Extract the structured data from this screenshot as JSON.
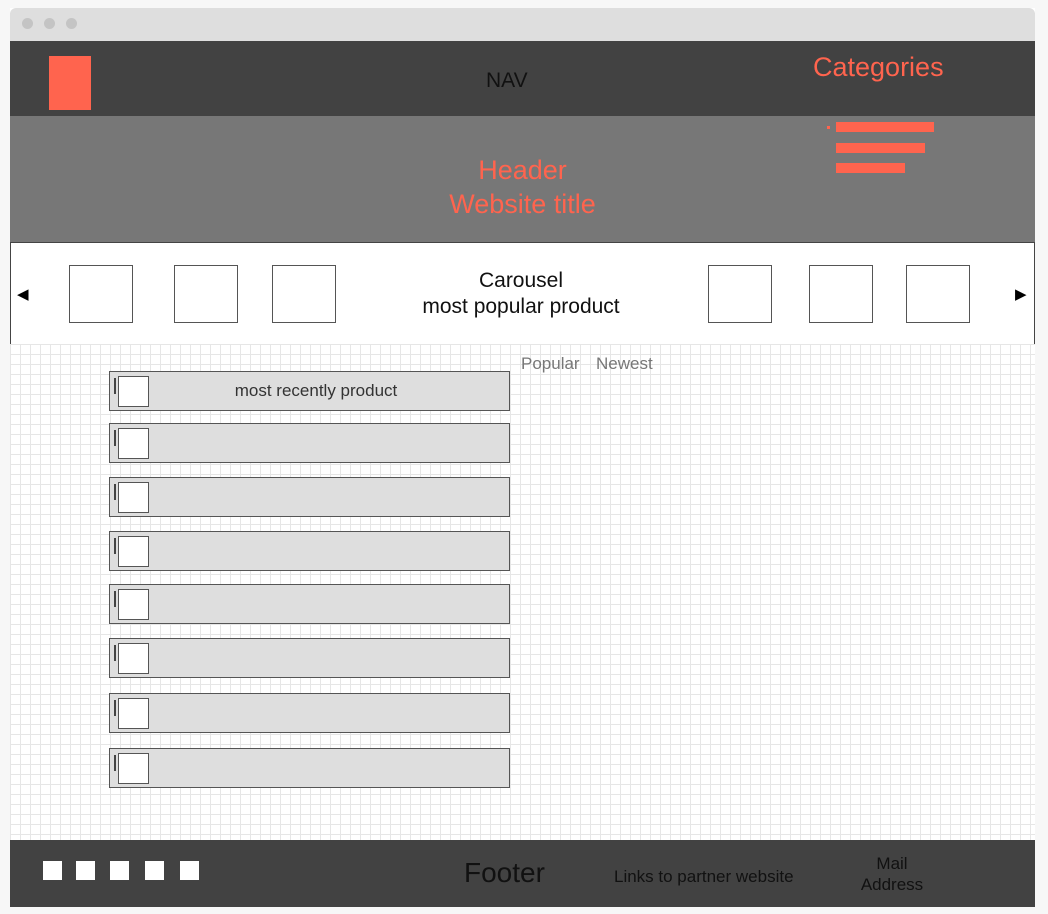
{
  "window": {
    "controls": [
      "close",
      "minimize",
      "maximize"
    ]
  },
  "nav": {
    "label": "NAV",
    "logo_color": "#ff644e"
  },
  "categories": {
    "label": "Categories",
    "icon": "hamburger-menu-icon"
  },
  "header": {
    "line1": "Header",
    "line2": "Website title",
    "background": "#777777"
  },
  "carousel": {
    "line1": "Carousel",
    "line2": "most popular product",
    "prev_arrow": "◀",
    "next_arrow": "▶"
  },
  "sort_tabs": [
    {
      "label": "Popular"
    },
    {
      "label": "Newest"
    }
  ],
  "product_list": [
    {
      "label": "most recently product"
    },
    {
      "label": ""
    },
    {
      "label": ""
    },
    {
      "label": ""
    },
    {
      "label": ""
    },
    {
      "label": ""
    },
    {
      "label": ""
    },
    {
      "label": ""
    }
  ],
  "footer": {
    "label": "Footer",
    "links": "Links to partner website",
    "mail_line1": "Mail",
    "mail_line2": "Address",
    "social_icon_count": 5
  },
  "colors": {
    "accent": "#ff644e",
    "dark": "#424242",
    "gray": "#777777"
  }
}
